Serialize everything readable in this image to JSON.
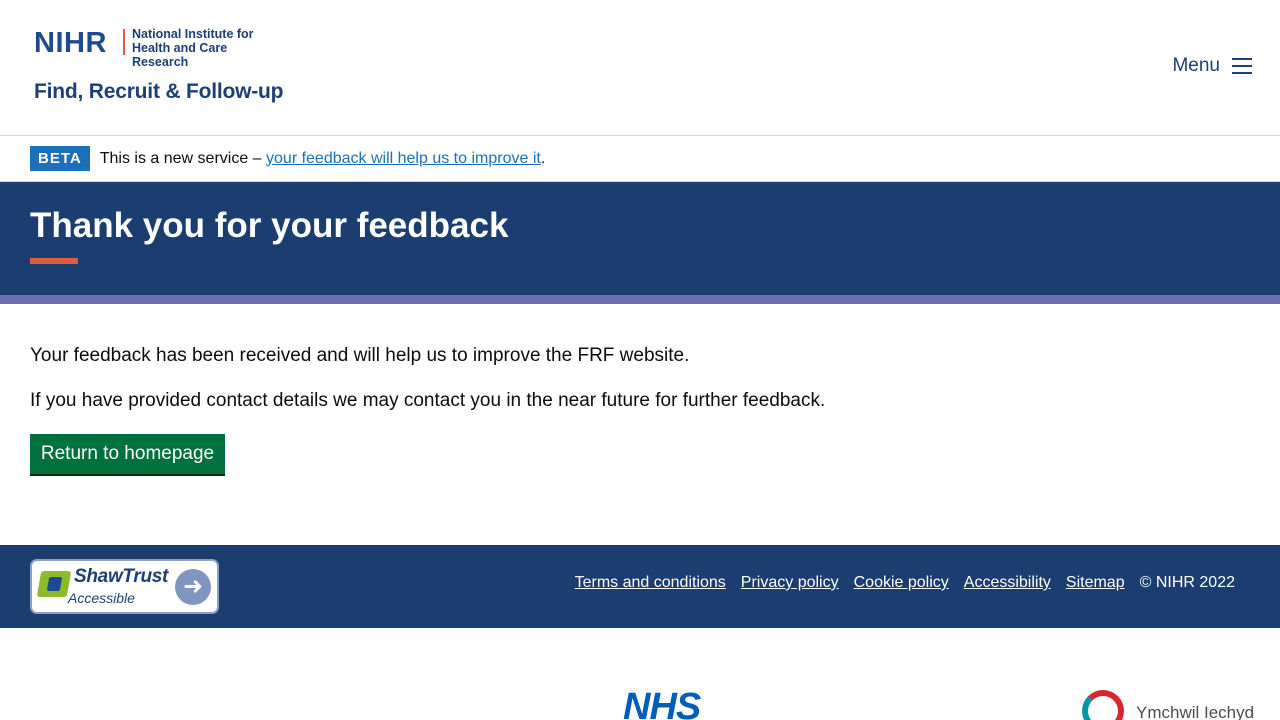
{
  "header": {
    "logo_abbrev": "NIHR",
    "logo_institute_line1": "National Institute for",
    "logo_institute_line2": "Health and Care Research",
    "service_name": "Find, Recruit & Follow-up",
    "menu_label": "Menu",
    "menu_icon": "hamburger-icon"
  },
  "beta_banner": {
    "tag": "BETA",
    "text": "This is a new service – ",
    "link_text": "your feedback will help us to improve it",
    "suffix": "."
  },
  "hero": {
    "title": "Thank you for your feedback"
  },
  "main": {
    "paragraph_1": "Your feedback has been received and will help us to improve the FRF website.",
    "paragraph_2": "If you have provided contact details we may contact you in the near future for further feedback.",
    "button_label": "Return to homepage"
  },
  "footer": {
    "badge_title": "ShawTrust",
    "badge_sub": "Accessible",
    "links": [
      "Terms and conditions",
      "Privacy policy",
      "Cookie policy",
      "Accessibility",
      "Sitemap"
    ],
    "copyright": "© NIHR 2022"
  },
  "partners": {
    "nhs_logo": "NHS",
    "hcrw_text": "Ymchwil Iechyd"
  },
  "colors": {
    "brand_navy": "#1b3d6f",
    "accent_red": "#e05a47",
    "purple_strip": "#6e6cb1",
    "button_green": "#00703c",
    "beta_blue": "#1d70b8"
  }
}
